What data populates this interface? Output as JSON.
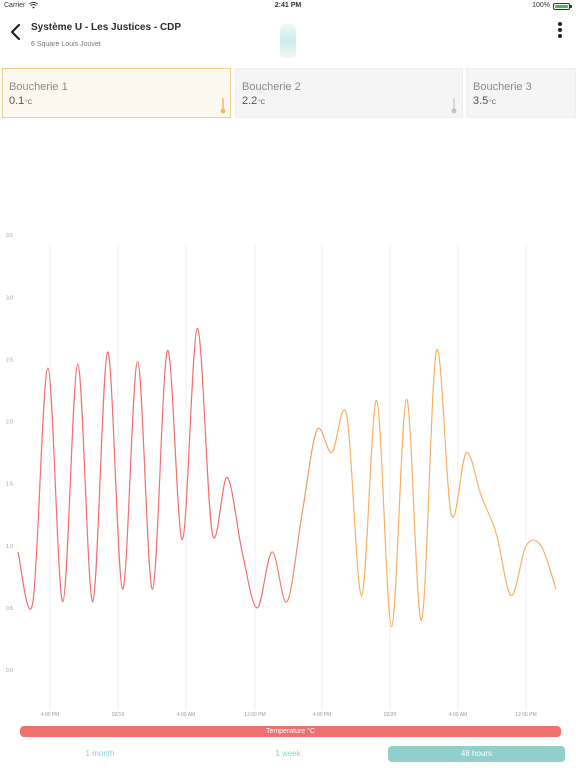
{
  "status_bar": {
    "carrier": "Carrier",
    "time": "2:41 PM",
    "battery": "100%"
  },
  "header": {
    "title": "Système U - Les Justices - CDP",
    "subtitle": "6 Square Louis Jouvet"
  },
  "sensors": [
    {
      "name": "Boucherie 1",
      "value": "0.1",
      "unit": "°C",
      "active": true
    },
    {
      "name": "Boucherie 2",
      "value": "2.2",
      "unit": "°C",
      "active": false
    },
    {
      "name": "Boucherie 3",
      "value": "3.5",
      "unit": "°C",
      "active": false
    }
  ],
  "legend": {
    "label": "Temperature °C"
  },
  "ranges": {
    "month": "1 month",
    "week": "1 week",
    "hours": "48 hours",
    "selected": "48 hours"
  },
  "colors": {
    "series_start": "#f07070",
    "series_end": "#f6b165",
    "accent": "#8fd0cc",
    "active_card_border": "#f2cf8a"
  },
  "chart_data": {
    "type": "line",
    "ylim": [
      -0.5,
      3.5
    ],
    "y_ticks": [
      "3.5",
      "3.0",
      "2.5",
      "2.0",
      "1.5",
      "1.0",
      "0.5",
      "0.0"
    ],
    "x_ticks": [
      "4:00 PM",
      "02/19",
      "4:00 AM",
      "12:00 PM",
      "4:00 PM",
      "02/20",
      "4:00 AM",
      "12:00 PM"
    ],
    "grid": true,
    "series": [
      {
        "name": "Temperature °C",
        "values": [
          0.45,
          0.05,
          1.93,
          0.05,
          1.96,
          0.05,
          2.06,
          0.15,
          1.98,
          0.15,
          2.07,
          0.55,
          2.25,
          0.6,
          1.05,
          0.45,
          -0.0,
          0.45,
          0.05,
          0.75,
          1.43,
          1.25,
          1.55,
          0.1,
          1.67,
          -0.15,
          1.68,
          -0.1,
          2.07,
          0.75,
          1.25,
          0.9,
          0.6,
          0.1,
          0.5,
          0.5,
          0.15
        ]
      }
    ]
  }
}
